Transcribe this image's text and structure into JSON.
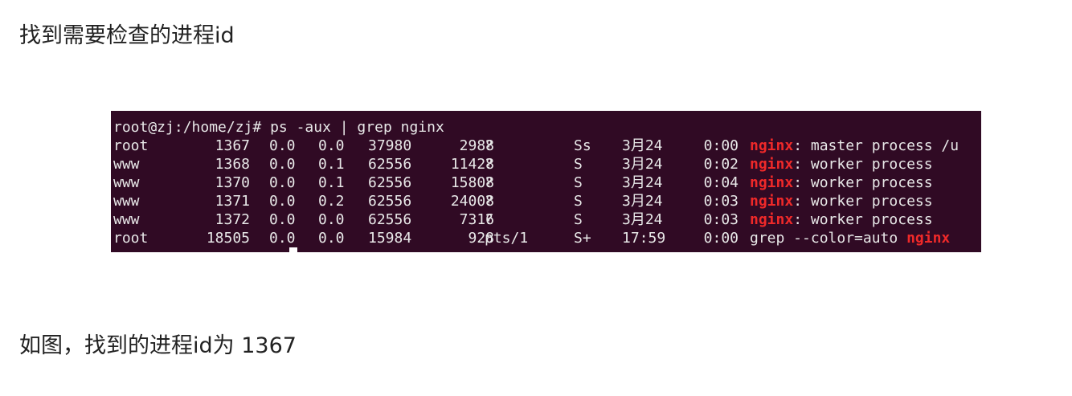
{
  "heading": "找到需要检查的进程id",
  "caption": "如图，找到的进程id为 1367",
  "terminal": {
    "command_line": "root@zj:/home/zj# ps -aux | grep nginx",
    "rows": [
      {
        "user": "root",
        "pid": "1367",
        "cpu": "0.0",
        "mem": "0.0",
        "vsz": "37980",
        "rss": "2988",
        "tty": "?",
        "stat": "Ss",
        "start": "3月24",
        "time": "0:00",
        "cmd_pre": "",
        "cmd_hl": "nginx",
        "cmd_post": ": master process /u"
      },
      {
        "user": "www",
        "pid": "1368",
        "cpu": "0.0",
        "mem": "0.1",
        "vsz": "62556",
        "rss": "11428",
        "tty": "?",
        "stat": "S",
        "start": "3月24",
        "time": "0:02",
        "cmd_pre": "",
        "cmd_hl": "nginx",
        "cmd_post": ": worker process"
      },
      {
        "user": "www",
        "pid": "1370",
        "cpu": "0.0",
        "mem": "0.1",
        "vsz": "62556",
        "rss": "15808",
        "tty": "?",
        "stat": "S",
        "start": "3月24",
        "time": "0:04",
        "cmd_pre": "",
        "cmd_hl": "nginx",
        "cmd_post": ": worker process"
      },
      {
        "user": "www",
        "pid": "1371",
        "cpu": "0.0",
        "mem": "0.2",
        "vsz": "62556",
        "rss": "24008",
        "tty": "?",
        "stat": "S",
        "start": "3月24",
        "time": "0:03",
        "cmd_pre": "",
        "cmd_hl": "nginx",
        "cmd_post": ": worker process"
      },
      {
        "user": "www",
        "pid": "1372",
        "cpu": "0.0",
        "mem": "0.0",
        "vsz": "62556",
        "rss": "7316",
        "tty": "?",
        "stat": "S",
        "start": "3月24",
        "time": "0:03",
        "cmd_pre": "",
        "cmd_hl": "nginx",
        "cmd_post": ": worker process"
      },
      {
        "user": "root",
        "pid": "18505",
        "cpu": "0.0",
        "mem": "0.0",
        "vsz": "15984",
        "rss": "928",
        "tty": "pts/1",
        "stat": "S+",
        "start": "17:59",
        "time": "0:00",
        "cmd_pre": "grep --color=auto ",
        "cmd_hl": "nginx",
        "cmd_post": ""
      }
    ],
    "colors": {
      "background": "#300a24",
      "text": "#e8e8e8",
      "highlight": "#ef2929"
    }
  }
}
